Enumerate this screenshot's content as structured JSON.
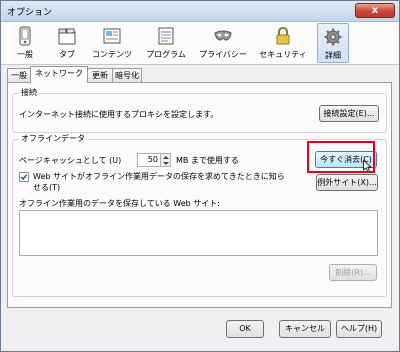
{
  "window": {
    "title": "オプション",
    "close_glyph": "x"
  },
  "toolbar": {
    "panes": [
      {
        "label": "一般",
        "icon": "phone-icon"
      },
      {
        "label": "タブ",
        "icon": "tabs-icon"
      },
      {
        "label": "コンテンツ",
        "icon": "content-icon"
      },
      {
        "label": "プログラム",
        "icon": "programs-icon"
      },
      {
        "label": "プライバシー",
        "icon": "mask-icon"
      },
      {
        "label": "セキュリティ",
        "icon": "padlock-icon"
      },
      {
        "label": "詳細",
        "icon": "gear-icon"
      }
    ],
    "selected": "詳細"
  },
  "tabs": {
    "general": "一般",
    "network": "ネットワーク",
    "update": "更新",
    "encryption": "暗号化",
    "active": "ネットワーク"
  },
  "connection": {
    "group_label": "接続",
    "description": "インターネット接続に使用するプロキシを設定します。",
    "settings_button": "接続設定(E)..."
  },
  "offline": {
    "group_label": "オフラインデータ",
    "cache_label": "ページキャッシュとして (U)",
    "cache_value": "50",
    "cache_unit": "MB まで使用する",
    "clear_now_button": "今すぐ消去(C)",
    "notify_line1": "Web サイトがオフライン作業用データの保存を求めてきたときに知ら",
    "notify_line2": "せる(T)",
    "notify_checked": true,
    "exceptions_button": "例外サイト(X)...",
    "sites_label": "オフライン作業用のデータを保存している Web サイト:",
    "remove_button": "削除(R)..."
  },
  "footer": {
    "ok": "OK",
    "cancel": "キャンセル",
    "help": "ヘルプ(H)"
  },
  "colors": {
    "highlight": "#e0001b",
    "selected_pane": "#cfe1f5"
  }
}
